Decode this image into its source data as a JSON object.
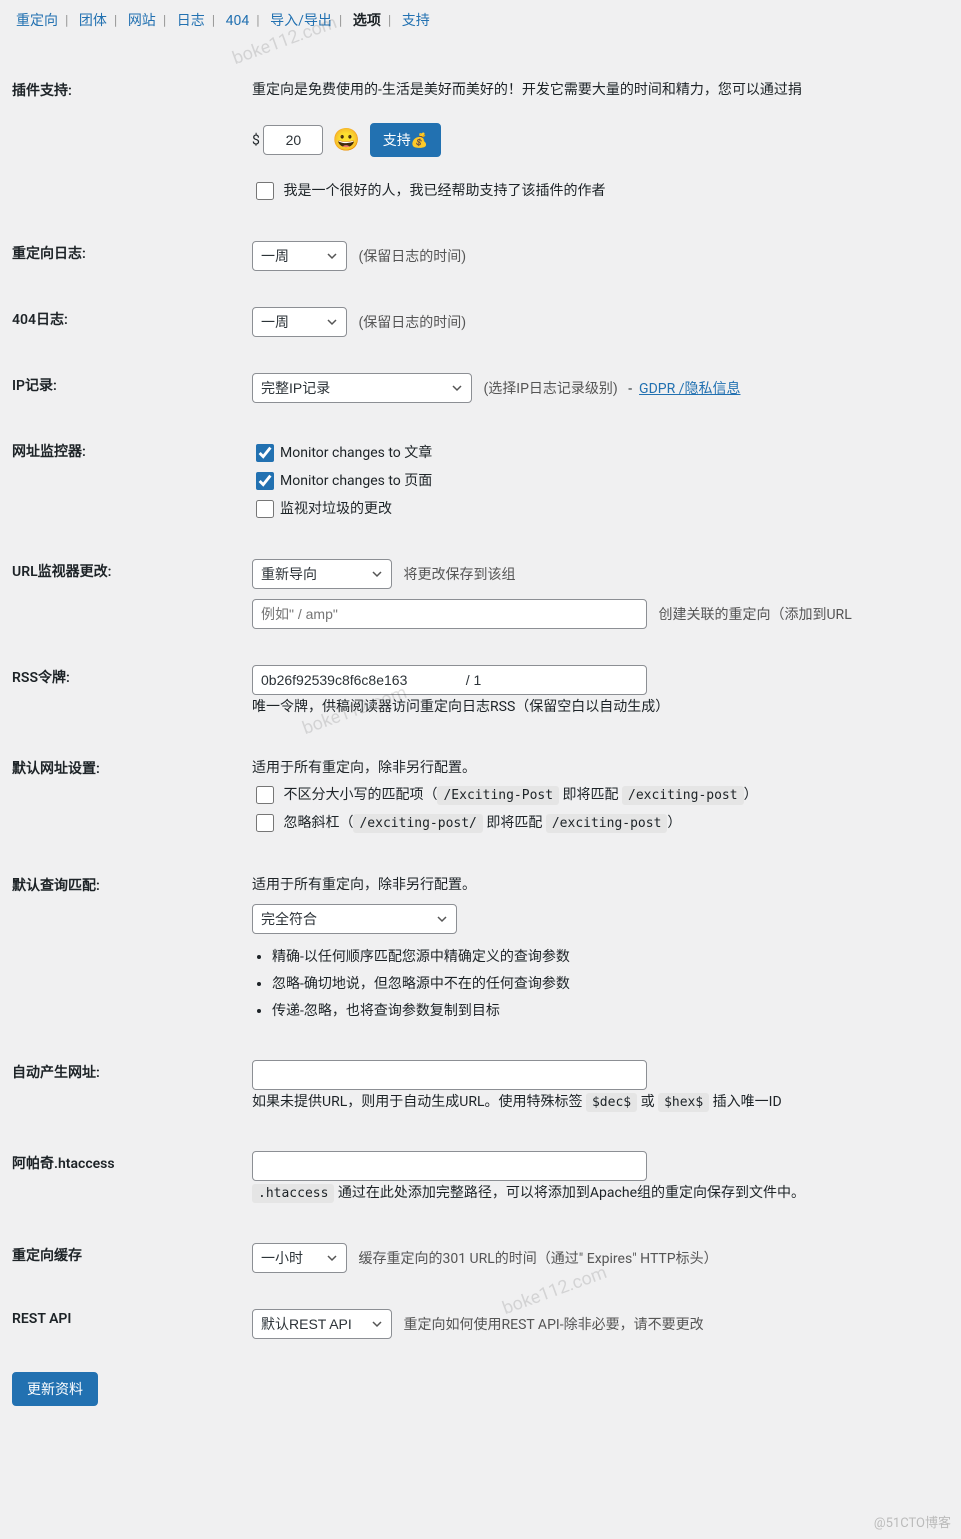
{
  "nav": {
    "items": [
      {
        "label": "重定向",
        "active": false
      },
      {
        "label": "团体",
        "active": false
      },
      {
        "label": "网站",
        "active": false
      },
      {
        "label": "日志",
        "active": false
      },
      {
        "label": "404",
        "active": false
      },
      {
        "label": "导入/导出",
        "active": false
      },
      {
        "label": "选项",
        "active": true
      },
      {
        "label": "支持",
        "active": false
      }
    ]
  },
  "pluginSupport": {
    "label": "插件支持:",
    "desc": "重定向是免费使用的-生活是美好而美好的！开发它需要大量的时间和精力，您可以通过捐",
    "currency": "$",
    "amount": "20",
    "emoji": "😀",
    "supportBtn": "支持💰",
    "niceLabel": "我是一个很好的人，我已经帮助支持了该插件的作者"
  },
  "redirectLog": {
    "label": "重定向日志:",
    "value": "一周",
    "help": "(保留日志的时间)"
  },
  "log404": {
    "label": "404日志:",
    "value": "一周",
    "help": "(保留日志的时间)"
  },
  "ipLog": {
    "label": "IP记录:",
    "value": "完整IP记录",
    "help": "(选择IP日志记录级别)",
    "linkSep": "-",
    "link": "GDPR /隐私信息"
  },
  "urlMonitor": {
    "label": "网址监控器:",
    "check1": "Monitor changes to 文章",
    "check2": "Monitor changes to 页面",
    "check3": "监视对垃圾的更改"
  },
  "urlMonitorChange": {
    "label": "URL监视器更改:",
    "selectValue": "重新导向",
    "help1": "将更改保存到该组",
    "placeholder": "例如\" / amp\"",
    "help2": "创建关联的重定向（添加到URL"
  },
  "rss": {
    "label": "RSS令牌:",
    "value": "0b26f92539c8f6c8e163               / 1",
    "help": "唯一令牌，供稿阅读器访问重定向日志RSS（保留空白以自动生成）"
  },
  "defaultUrl": {
    "label": "默认网址设置:",
    "desc": "适用于所有重定向，除非另行配置。",
    "case_prefix": "不区分大小写的匹配项（",
    "case_code1": "/Exciting-Post",
    "case_mid": " 即将匹配 ",
    "case_code2": "/exciting-post",
    "case_suffix": "）",
    "slash_prefix": "忽略斜杠（",
    "slash_code1": "/exciting-post/",
    "slash_mid": " 即将匹配 ",
    "slash_code2": "/exciting-post",
    "slash_suffix": "）"
  },
  "defaultQuery": {
    "label": "默认查询匹配:",
    "desc": "适用于所有重定向，除非另行配置。",
    "selectValue": "完全符合",
    "bullets": [
      "精确-以任何顺序匹配您源中精确定义的查询参数",
      "忽略-确切地说，但忽略源中不在的任何查询参数",
      "传递-忽略，也将查询参数复制到目标"
    ]
  },
  "autoUrl": {
    "label": "自动产生网址:",
    "help_prefix": "如果未提供URL，则用于自动生成URL。使用特殊标签 ",
    "code1": "$dec$",
    "or": " 或 ",
    "code2": "$hex$",
    "help_suffix": " 插入唯一ID"
  },
  "htaccess": {
    "label": "阿帕奇.htaccess",
    "code": ".htaccess",
    "help": " 通过在此处添加完整路径，可以将添加到Apache组的重定向保存到文件中。"
  },
  "cache": {
    "label": "重定向缓存",
    "value": "一小时",
    "help": "缓存重定向的301 URL的时间（通过\" Expires\" HTTP标头）"
  },
  "rest": {
    "label": "REST API",
    "value": "默认REST API",
    "help": "重定向如何使用REST API-除非必要，请不要更改"
  },
  "submit": "更新资料",
  "watermarks": [
    "boke112.com",
    "boke112.com",
    "boke112.com"
  ],
  "footer": "@51CTO博客"
}
